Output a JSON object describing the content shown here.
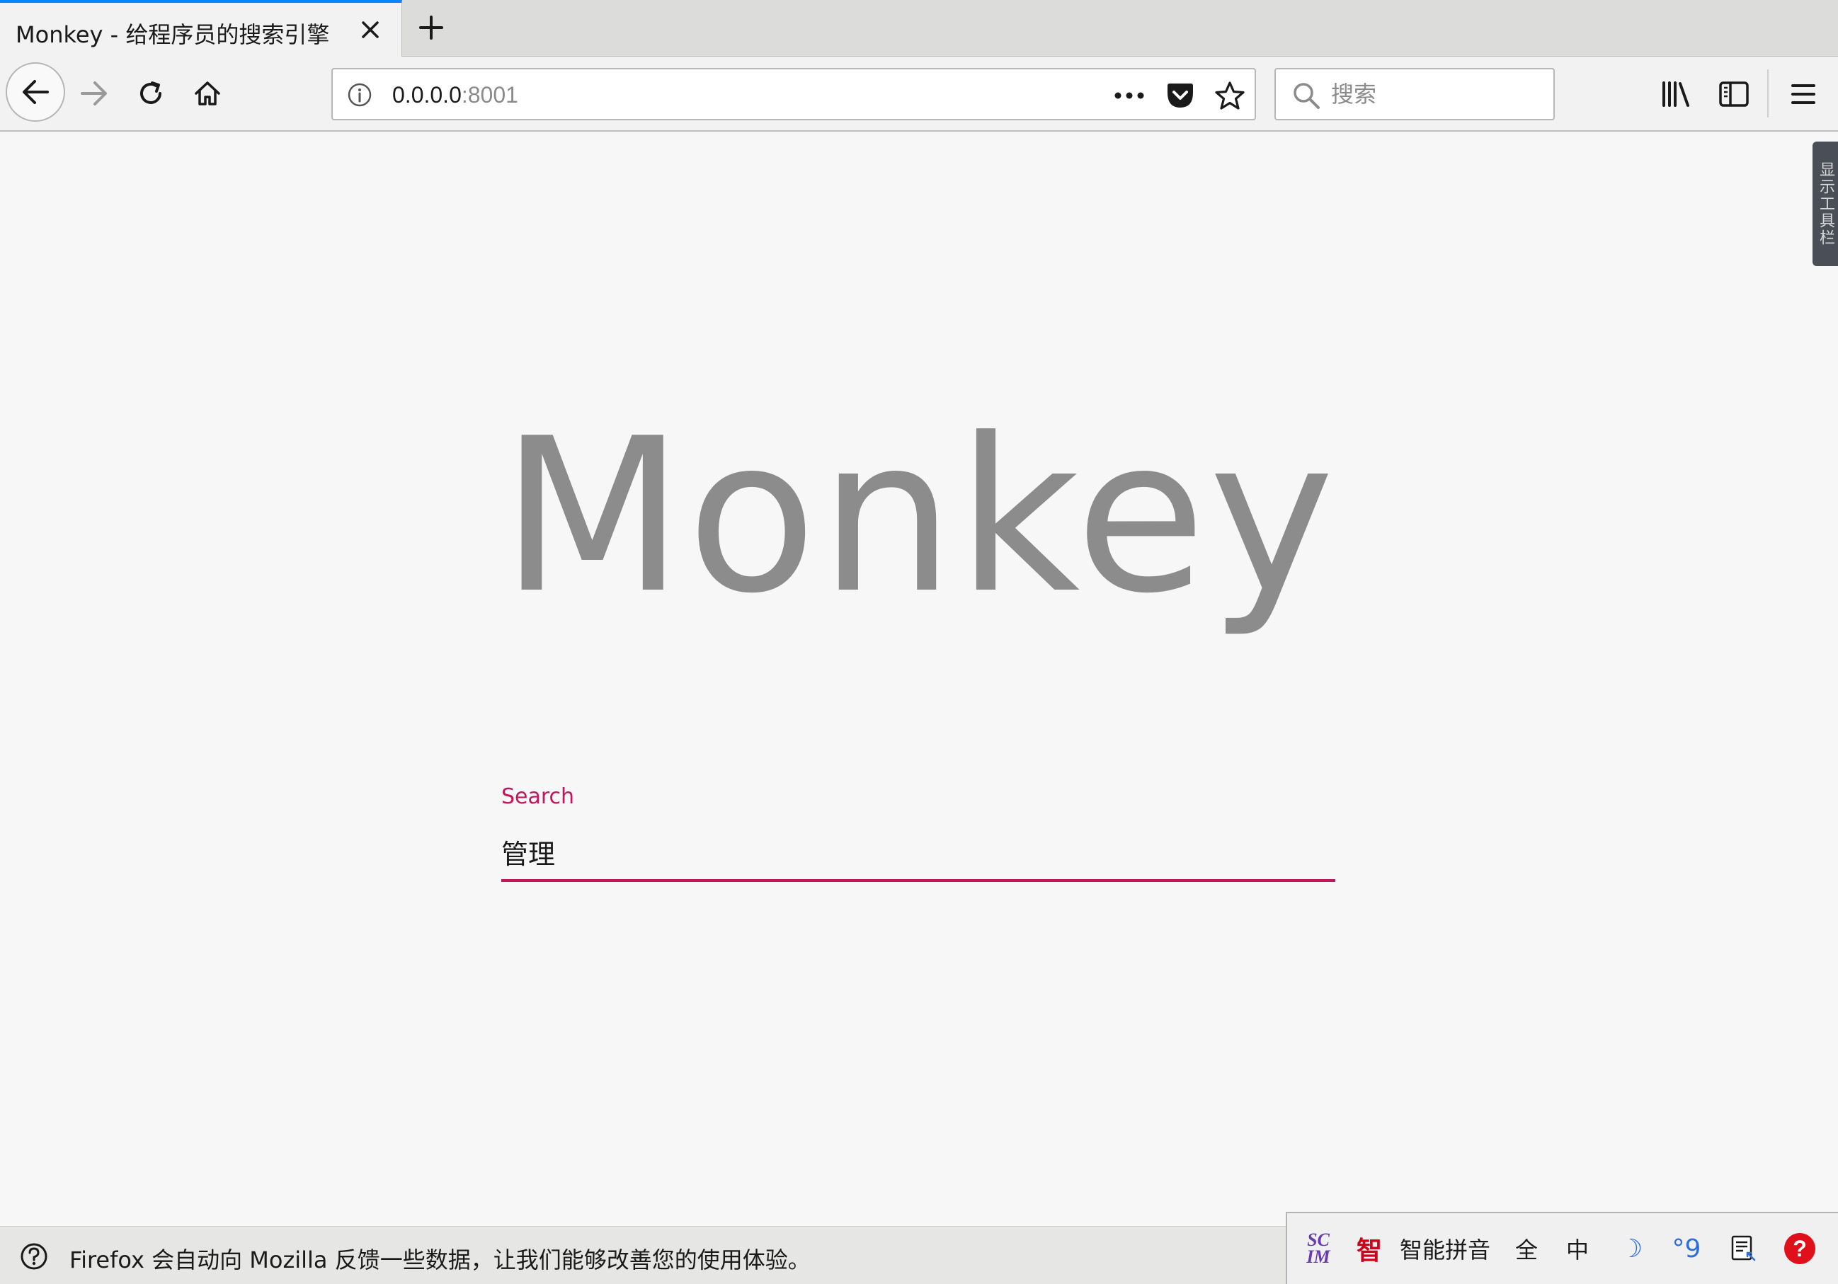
{
  "browser": {
    "tab": {
      "title": "Monkey - 给程序员的搜索引擎",
      "close_icon": "close-icon",
      "new_tab_icon": "plus-icon"
    },
    "nav": {
      "back_icon": "arrow-left-icon",
      "forward_icon": "arrow-right-icon",
      "reload_icon": "reload-icon",
      "home_icon": "home-icon"
    },
    "urlbar": {
      "host": "0.0.0.0",
      "port": ":8001",
      "info_icon": "info-icon",
      "page_actions_icon": "more-dots-icon",
      "pocket_icon": "pocket-icon",
      "bookmark_icon": "star-icon"
    },
    "searchbar": {
      "placeholder": "搜索",
      "search_icon": "search-icon"
    },
    "toolbar": {
      "library_icon": "library-icon",
      "sidebar_icon": "sidebar-icon",
      "menu_icon": "hamburger-menu-icon"
    },
    "side_handle_label": "显示工具栏"
  },
  "page": {
    "logo": "Monkey",
    "search_field": {
      "label": "Search",
      "value": "管理"
    },
    "accent_color": "#c2185b"
  },
  "notification": {
    "icon": "help-circle-icon",
    "text": "Firefox 会自动向 Mozilla 反馈一些数据，让我们能够改善您的使用体验。"
  },
  "ime": {
    "logo_top": "SC",
    "logo_bottom": "IM",
    "mode_char": "智",
    "name": "智能拼音",
    "width_mode": "全",
    "lang_mode": "中",
    "moon_glyph": "☽",
    "punct_glyph": "°9",
    "keyboard_icon": "soft-keyboard-icon",
    "help_glyph": "?"
  }
}
